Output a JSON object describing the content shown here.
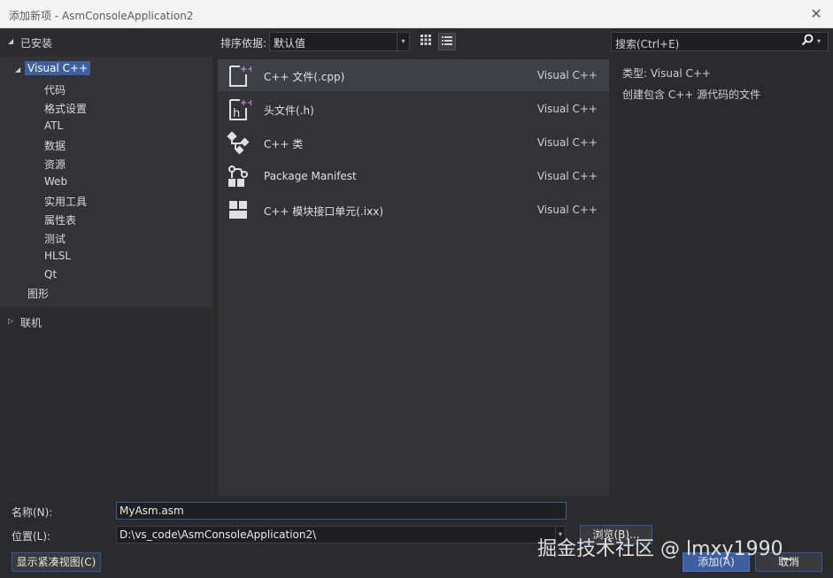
{
  "window": {
    "title": "添加新项 - AsmConsoleApplication2"
  },
  "tree": {
    "installed": "已安装",
    "selected": "Visual C++",
    "children": [
      "代码",
      "格式设置",
      "ATL",
      "数据",
      "资源",
      "Web",
      "实用工具",
      "属性表",
      "测试",
      "HLSL",
      "Qt"
    ],
    "graphics": "图形",
    "online": "联机"
  },
  "toolbar": {
    "sort_label": "排序依据:",
    "sort_value": "默认值"
  },
  "templates": [
    {
      "name": "C++ 文件(.cpp)",
      "lang": "Visual C++",
      "icon": "cpp-file-icon"
    },
    {
      "name": "头文件(.h)",
      "lang": "Visual C++",
      "icon": "header-file-icon"
    },
    {
      "name": "C++ 类",
      "lang": "Visual C++",
      "icon": "class-icon"
    },
    {
      "name": "Package Manifest",
      "lang": "Visual C++",
      "icon": "package-manifest-icon"
    },
    {
      "name": "C++ 模块接口单元(.ixx)",
      "lang": "Visual C++",
      "icon": "module-icon"
    }
  ],
  "search": {
    "placeholder": "搜索(Ctrl+E)"
  },
  "info": {
    "type": "类型:  Visual C++",
    "description": "创建包含 C++ 源代码的文件"
  },
  "form": {
    "name_label": "名称(N):",
    "name_value": "MyAsm.asm",
    "location_label": "位置(L):",
    "location_value": "D:\\vs_code\\AsmConsoleApplication2\\",
    "browse": "浏览(B)...",
    "compact": "显示紧凑视图(C)",
    "add": "添加(A)",
    "cancel": "取消"
  },
  "watermark": "掘金技术社区 @ lmxy1990_"
}
